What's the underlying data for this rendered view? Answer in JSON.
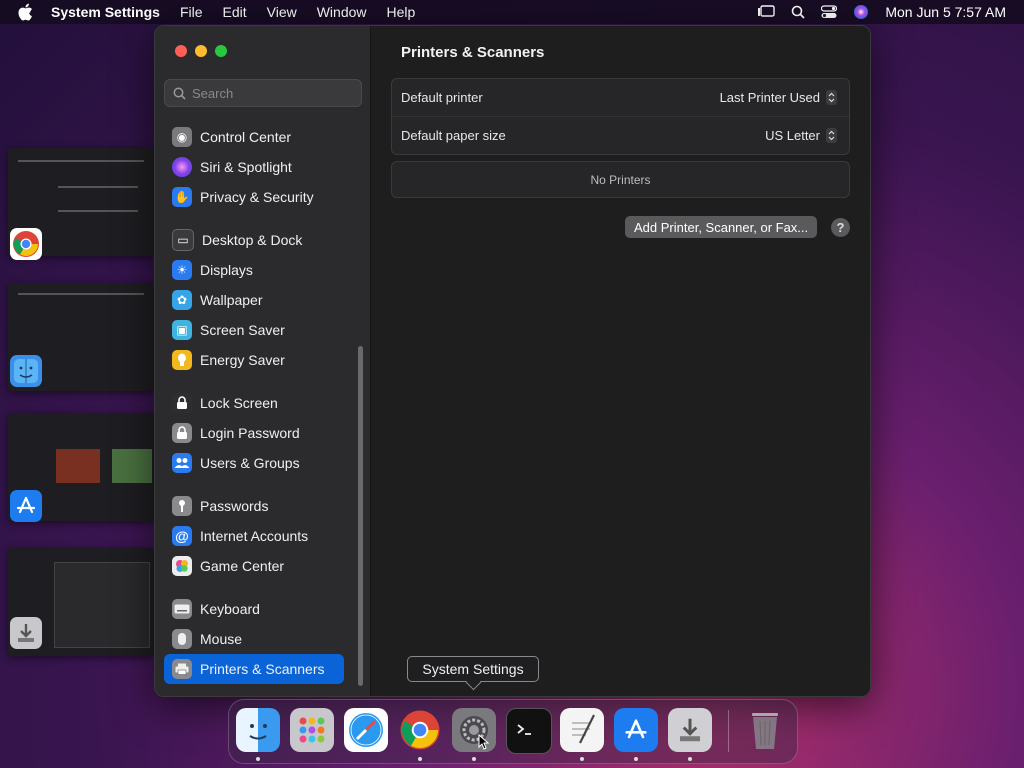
{
  "menubar": {
    "app_name": "System Settings",
    "menus": [
      "File",
      "Edit",
      "View",
      "Window",
      "Help"
    ],
    "clock": "Mon Jun 5  7:57 AM"
  },
  "sidebar": {
    "search_placeholder": "Search",
    "items": [
      {
        "label": "Control Center",
        "icon": "control-center-icon",
        "color": "#7a7a7c",
        "glyph": "◉"
      },
      {
        "label": "Siri & Spotlight",
        "icon": "siri-icon",
        "color": "#b03fd8",
        "glyph": "●"
      },
      {
        "label": "Privacy & Security",
        "icon": "hand-icon",
        "color": "#2a7bf0",
        "glyph": "✋"
      },
      {
        "label": "Desktop & Dock",
        "icon": "desktop-dock-icon",
        "color": "#3a3a3c",
        "glyph": "▭"
      },
      {
        "label": "Displays",
        "icon": "displays-icon",
        "color": "#2a7bf0",
        "glyph": "☀"
      },
      {
        "label": "Wallpaper",
        "icon": "wallpaper-icon",
        "color": "#36a5e8",
        "glyph": "✿"
      },
      {
        "label": "Screen Saver",
        "icon": "screen-saver-icon",
        "color": "#40b4e0",
        "glyph": "▣"
      },
      {
        "label": "Energy Saver",
        "icon": "energy-saver-icon",
        "color": "#f2b81e",
        "glyph": "●"
      },
      {
        "label": "Lock Screen",
        "icon": "lock-screen-icon",
        "color": "#2e2e30",
        "glyph": "🔒"
      },
      {
        "label": "Login Password",
        "icon": "login-password-icon",
        "color": "#8a8a8c",
        "glyph": "🔒"
      },
      {
        "label": "Users & Groups",
        "icon": "users-groups-icon",
        "color": "#2a7bf0",
        "glyph": "👥"
      },
      {
        "label": "Passwords",
        "icon": "key-icon",
        "color": "#8a8a8c",
        "glyph": "⚷"
      },
      {
        "label": "Internet Accounts",
        "icon": "at-icon",
        "color": "#2a7bf0",
        "glyph": "@"
      },
      {
        "label": "Game Center",
        "icon": "game-center-icon",
        "color": "#e8e8e8",
        "glyph": "●"
      },
      {
        "label": "Keyboard",
        "icon": "keyboard-icon",
        "color": "#8a8a8c",
        "glyph": "⌨"
      },
      {
        "label": "Mouse",
        "icon": "mouse-icon",
        "color": "#8a8a8c",
        "glyph": "▮"
      },
      {
        "label": "Printers & Scanners",
        "icon": "printer-icon",
        "color": "#8a8a8c",
        "glyph": "⎙",
        "active": true
      }
    ]
  },
  "content": {
    "title": "Printers & Scanners",
    "default_printer_label": "Default printer",
    "default_printer_value": "Last Printer Used",
    "paper_size_label": "Default paper size",
    "paper_size_value": "US Letter",
    "no_printers": "No Printers",
    "add_button": "Add Printer, Scanner, or Fax...",
    "help_label": "?"
  },
  "tooltip": "System Settings",
  "dock": {
    "apps": [
      "Finder",
      "Launchpad",
      "Safari",
      "Chrome",
      "System Settings",
      "Terminal",
      "TextEdit",
      "App Store",
      "Downloads",
      "Trash"
    ]
  },
  "colors": {
    "accent": "#0a64d8",
    "close": "#ff5f57",
    "minimize": "#febc2e",
    "zoom": "#28c840"
  }
}
